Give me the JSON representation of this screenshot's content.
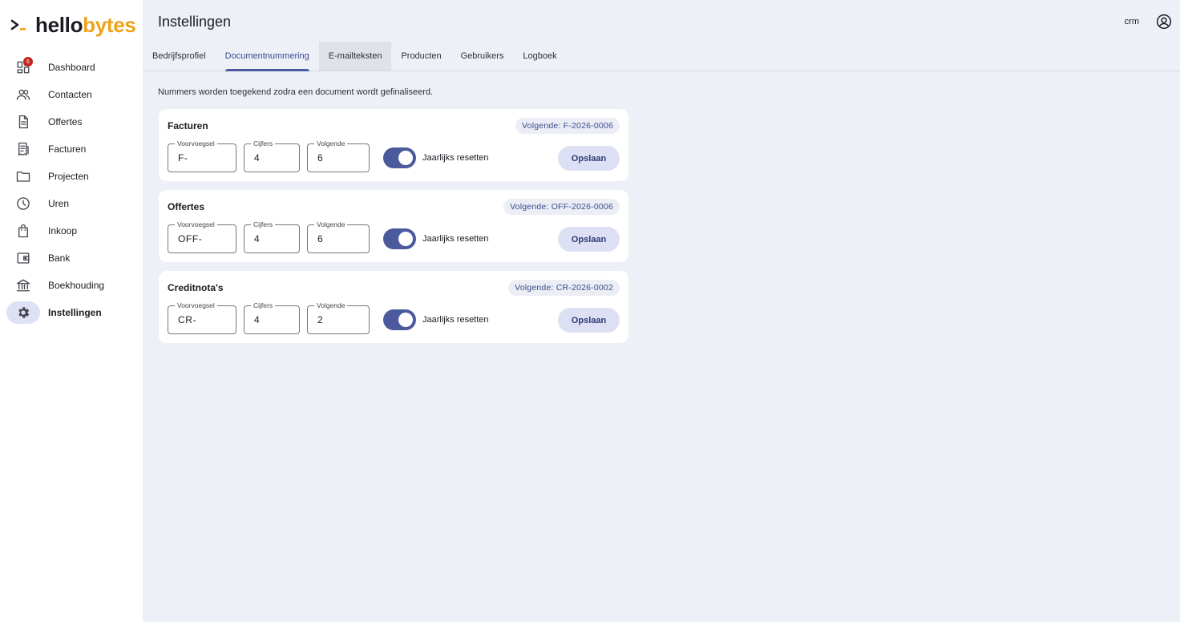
{
  "brand": {
    "hello": "hello",
    "bytes": "bytes",
    "accent": "#f0a21a"
  },
  "header": {
    "title": "Instellingen",
    "user": "crm",
    "account_icon": "account-circle-icon"
  },
  "sidebar": {
    "items": [
      {
        "label": "Dashboard",
        "icon": "dashboard-icon",
        "badge": "6"
      },
      {
        "label": "Contacten",
        "icon": "people-icon"
      },
      {
        "label": "Offertes",
        "icon": "document-icon"
      },
      {
        "label": "Facturen",
        "icon": "receipt-icon"
      },
      {
        "label": "Projecten",
        "icon": "folder-icon"
      },
      {
        "label": "Uren",
        "icon": "clock-icon"
      },
      {
        "label": "Inkoop",
        "icon": "shopping-bag-icon"
      },
      {
        "label": "Bank",
        "icon": "wallet-icon"
      },
      {
        "label": "Boekhouding",
        "icon": "bank-icon"
      },
      {
        "label": "Instellingen",
        "icon": "gear-icon",
        "active": true
      }
    ]
  },
  "tabs": [
    {
      "label": "Bedrijfsprofiel"
    },
    {
      "label": "Documentnummering",
      "active": true
    },
    {
      "label": "E-mailteksten",
      "hover": true
    },
    {
      "label": "Producten"
    },
    {
      "label": "Gebruikers"
    },
    {
      "label": "Logboek"
    }
  ],
  "intro": "Nummers worden toegekend zodra een document wordt gefinaliseerd.",
  "labels": {
    "prefix": "Voorvoegsel",
    "digits": "Cijfers",
    "next": "Volgende",
    "reset": "Jaarlijks resetten",
    "save": "Opslaan"
  },
  "cards": [
    {
      "title": "Facturen",
      "next_preview": "Volgende: F-2026-0006",
      "prefix": "F-",
      "digits": "4",
      "next": "6",
      "yearly_reset": true
    },
    {
      "title": "Offertes",
      "next_preview": "Volgende: OFF-2026-0006",
      "prefix": "OFF-",
      "digits": "4",
      "next": "6",
      "yearly_reset": true
    },
    {
      "title": "Creditnota's",
      "next_preview": "Volgende: CR-2026-0002",
      "prefix": "CR-",
      "digits": "4",
      "next": "2",
      "yearly_reset": true
    }
  ]
}
